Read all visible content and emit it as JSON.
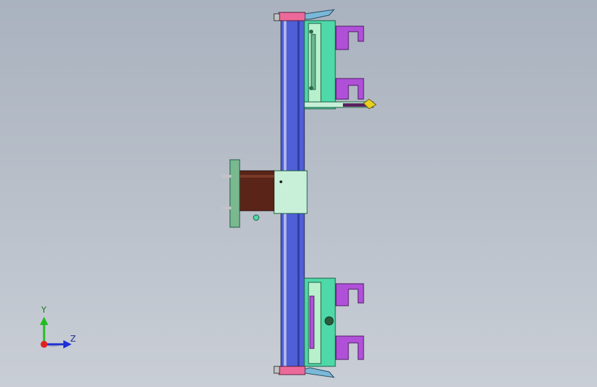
{
  "viewport": {
    "background_top": "#a9b2bf",
    "background_bottom": "#c9ced6"
  },
  "triad": {
    "y_label": "Y",
    "z_label": "Z",
    "colors": {
      "y": "#22bb22",
      "z": "#1e2fd6",
      "x": "#e02020"
    }
  },
  "model_colors": {
    "rail_blue": "#4f5fd6",
    "plate_green": "#4fd8a8",
    "plate_light": "#b8f0cc",
    "bracket_purple": "#b050d8",
    "cap_pink": "#ec6a9a",
    "motor_brown": "#5a2418",
    "flange_green": "#7ab890",
    "sensor_yellow": "#e8d020"
  }
}
